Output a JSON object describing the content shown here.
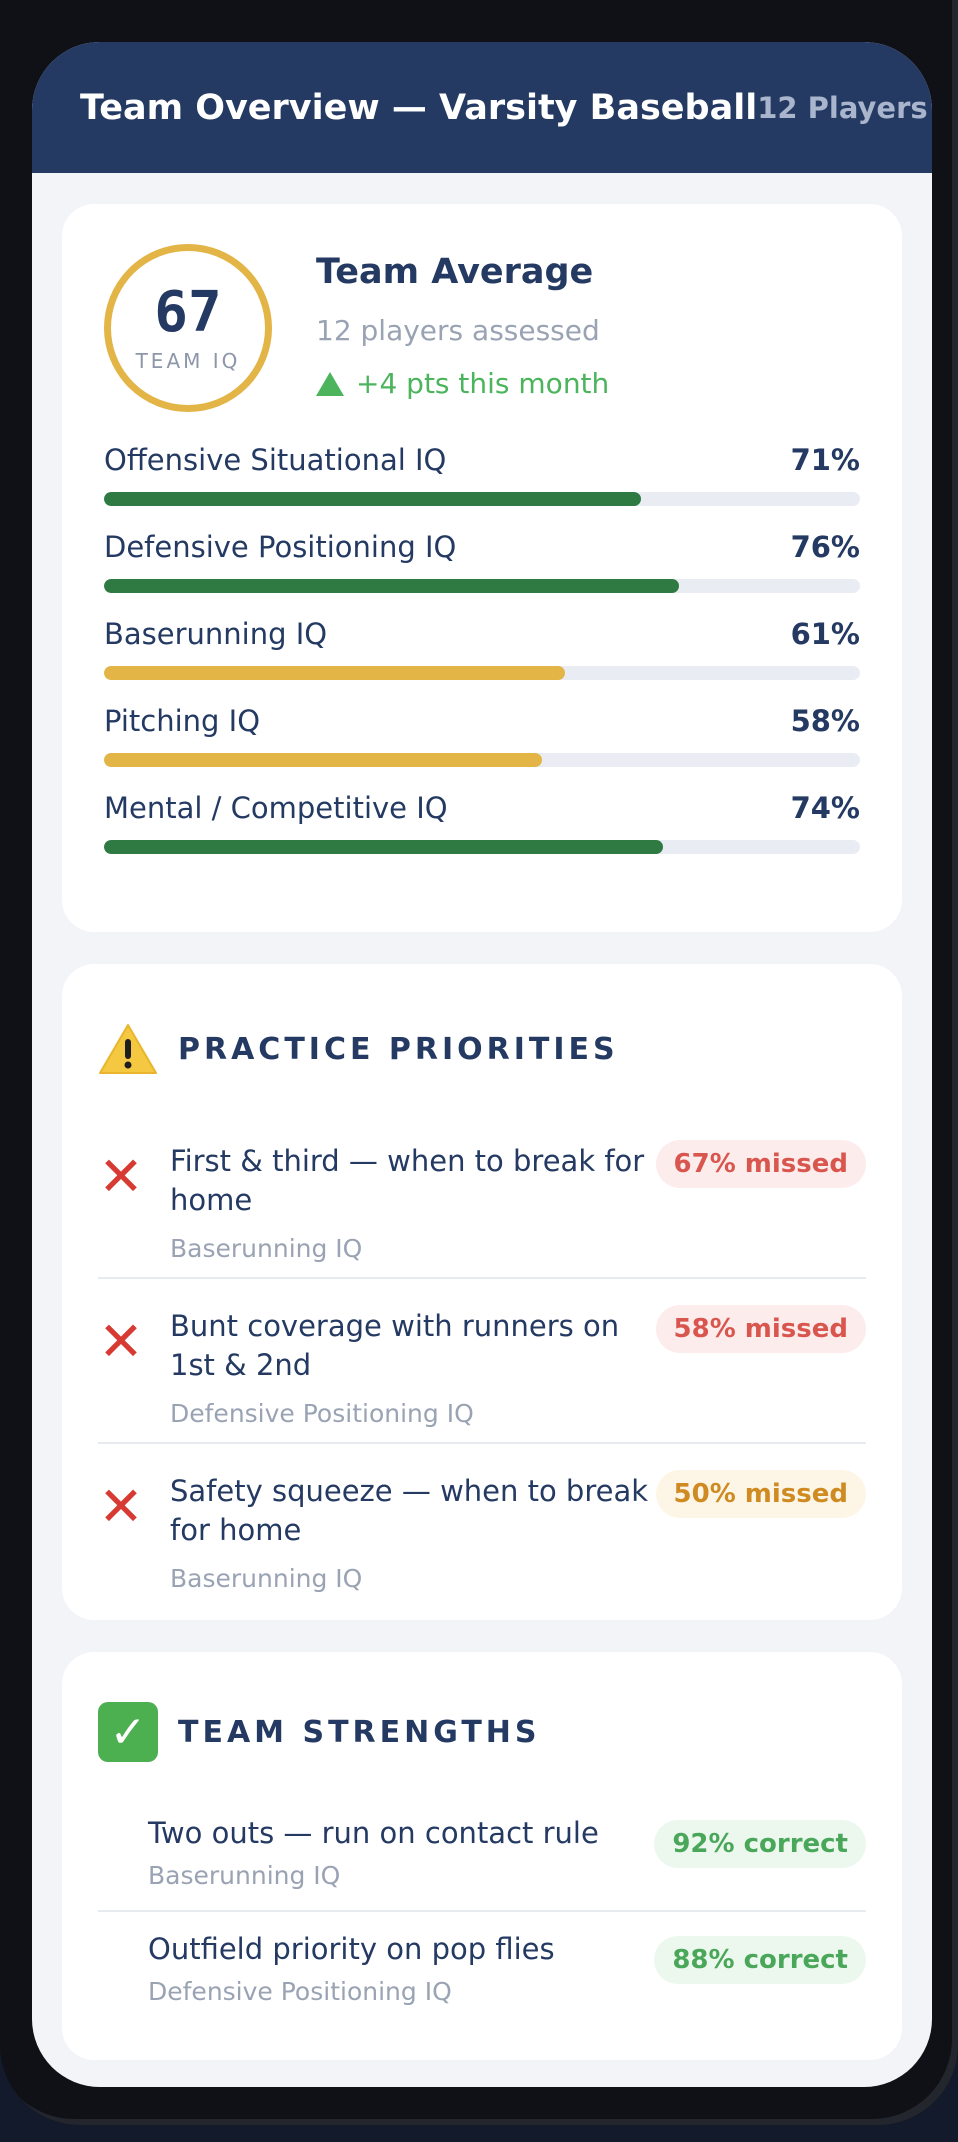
{
  "header": {
    "title": "Team Overview — Varsity Baseball",
    "player_count": "12 Players"
  },
  "summary": {
    "iq_score": "67",
    "iq_label": "TEAM IQ",
    "title": "Team Average",
    "subtitle": "12 players assessed",
    "trend": "+4 pts this month",
    "colors": {
      "ring": "#e3b446",
      "trend": "#4bb45d"
    }
  },
  "metrics": [
    {
      "label": "Offensive Situational IQ",
      "value": "71%",
      "fraction": 0.71,
      "color": "#2f7a42"
    },
    {
      "label": "Defensive Positioning IQ",
      "value": "76%",
      "fraction": 0.76,
      "color": "#2f7a42"
    },
    {
      "label": "Baserunning IQ",
      "value": "61%",
      "fraction": 0.61,
      "color": "#e3b446"
    },
    {
      "label": "Pitching IQ",
      "value": "58%",
      "fraction": 0.58,
      "color": "#e3b446"
    },
    {
      "label": "Mental / Competitive IQ",
      "value": "74%",
      "fraction": 0.74,
      "color": "#2f7a42"
    }
  ],
  "priorities": {
    "title": "PRACTICE PRIORITIES",
    "icon": "warning-icon",
    "items": [
      {
        "title": "First & third — when to break for home",
        "category": "Baserunning IQ",
        "badge": "67% missed",
        "severity": "red",
        "icon": "x-icon"
      },
      {
        "title": "Bunt coverage with runners on 1st & 2nd",
        "category": "Defensive Positioning IQ",
        "badge": "58% missed",
        "severity": "red",
        "icon": "x-icon"
      },
      {
        "title": "Safety squeeze — when to break for home",
        "category": "Baserunning IQ",
        "badge": "50% missed",
        "severity": "amber",
        "icon": "x-icon"
      }
    ]
  },
  "strengths": {
    "title": "TEAM STRENGTHS",
    "icon": "check-icon",
    "items": [
      {
        "title": "Two outs — run on contact rule",
        "category": "Baserunning IQ",
        "badge": "92% correct"
      },
      {
        "title": "Outfield priority on pop flies",
        "category": "Defensive Positioning IQ",
        "badge": "88% correct"
      }
    ]
  }
}
